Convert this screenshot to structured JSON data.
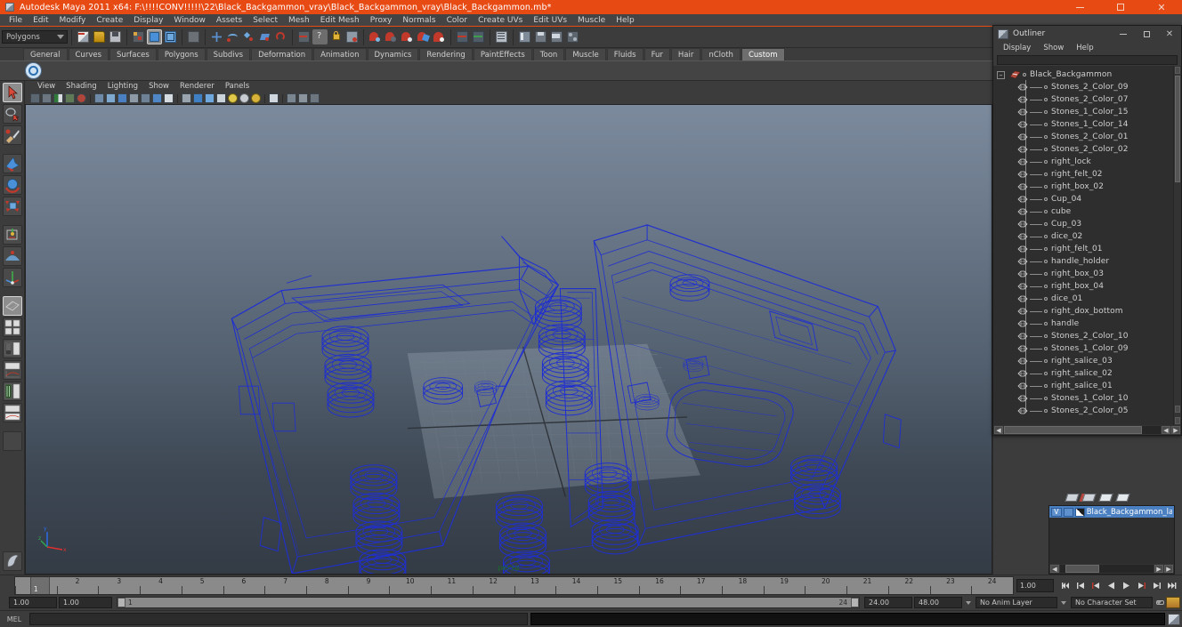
{
  "window": {
    "title": "Autodesk Maya 2011 x64: F:\\!!!!CONV!!!!!\\22\\Black_Backgammon_vray\\Black_Backgammon_vray\\Black_Backgammon.mb*",
    "app_icon": "maya-icon",
    "minimize": "minimize-icon",
    "maximize": "maximize-icon",
    "close": "close-icon",
    "titlebar_color": "#e84a14"
  },
  "menubar": {
    "items": [
      {
        "label": "File"
      },
      {
        "label": "Edit"
      },
      {
        "label": "Modify"
      },
      {
        "label": "Create"
      },
      {
        "label": "Display"
      },
      {
        "label": "Window"
      },
      {
        "label": "Assets"
      },
      {
        "label": "Select"
      },
      {
        "label": "Mesh"
      },
      {
        "label": "Edit Mesh"
      },
      {
        "label": "Proxy"
      },
      {
        "label": "Normals"
      },
      {
        "label": "Color"
      },
      {
        "label": "Create UVs"
      },
      {
        "label": "Edit UVs"
      },
      {
        "label": "Muscle"
      },
      {
        "label": "Help"
      }
    ]
  },
  "statusline": {
    "mode_selector": "Polygons",
    "icons": [
      "new-scene-icon",
      "open-scene-icon",
      "save-scene-icon",
      "select-by-hierarchy-icon",
      "select-by-object-icon",
      "select-by-component-icon",
      "select-mask-icon",
      "snap-to-grid-icon",
      "snap-to-curve-icon",
      "snap-to-point-icon",
      "snap-to-plane-icon",
      "snap-to-view-plane-icon",
      "snap-to-live-icon",
      "history-icon",
      "help-icon",
      "lock-icon",
      "render-current-frame-icon",
      "ipr-render-icon",
      "render-settings-icon",
      "hypershade-icon",
      "render-view-icon",
      "render-globals-icon",
      "show-hide-editor-icon",
      "open-editor-icon",
      "attribute-editor-icon",
      "channel-box-icon",
      "layer-editor-icon",
      "tool-settings-icon",
      "sidebar-toggle-icon"
    ]
  },
  "shelf": {
    "tabs": [
      {
        "label": "General",
        "active": false
      },
      {
        "label": "Curves",
        "active": false
      },
      {
        "label": "Surfaces",
        "active": false
      },
      {
        "label": "Polygons",
        "active": false
      },
      {
        "label": "Subdivs",
        "active": false
      },
      {
        "label": "Deformation",
        "active": false
      },
      {
        "label": "Animation",
        "active": false
      },
      {
        "label": "Dynamics",
        "active": false
      },
      {
        "label": "Rendering",
        "active": false
      },
      {
        "label": "PaintEffects",
        "active": false
      },
      {
        "label": "Toon",
        "active": false
      },
      {
        "label": "Muscle",
        "active": false
      },
      {
        "label": "Fluids",
        "active": false
      },
      {
        "label": "Fur",
        "active": false
      },
      {
        "label": "Hair",
        "active": false
      },
      {
        "label": "nCloth",
        "active": false
      },
      {
        "label": "Custom",
        "active": true
      }
    ],
    "buttons": [
      "vray-render-icon"
    ]
  },
  "toolbox": {
    "tools": [
      {
        "name": "select-tool",
        "selected": true
      },
      {
        "name": "lasso-select-tool",
        "selected": false
      },
      {
        "name": "paint-select-tool",
        "selected": false
      },
      {
        "name": "move-tool",
        "selected": false
      },
      {
        "name": "rotate-tool",
        "selected": false
      },
      {
        "name": "scale-tool",
        "selected": false
      },
      {
        "name": "universal-manipulator-tool",
        "selected": false
      },
      {
        "name": "soft-modification-tool",
        "selected": false
      },
      {
        "name": "last-tool-used",
        "selected": false
      }
    ],
    "layouts": [
      {
        "name": "single-perspective-layout",
        "selected": true
      },
      {
        "name": "four-view-layout",
        "selected": false
      },
      {
        "name": "outliner-persp-layout",
        "selected": false
      },
      {
        "name": "persp-graph-layout",
        "selected": false
      },
      {
        "name": "hypershade-persp-layout",
        "selected": false
      },
      {
        "name": "persp-graph-hypergraph-layout",
        "selected": false
      }
    ],
    "paint_icon": "paint-effects-icon"
  },
  "viewport": {
    "panel_menus": [
      {
        "label": "View"
      },
      {
        "label": "Shading"
      },
      {
        "label": "Lighting"
      },
      {
        "label": "Show"
      },
      {
        "label": "Renderer"
      },
      {
        "label": "Panels"
      }
    ],
    "panel_icons": [
      "select-camera-icon",
      "lock-camera-icon",
      "camera-attributes-icon",
      "bookmark-icon",
      "image-plane-icon",
      "two-d-pan-zoom-icon",
      "grid-toggle-icon",
      "film-gate-icon",
      "resolution-gate-icon",
      "field-chart-icon",
      "safe-action-icon",
      "safe-title-icon",
      "gate-mask-icon",
      "wireframe-icon",
      "smooth-shade-icon",
      "shaded-wireframe-icon",
      "hardware-texture-icon",
      "use-default-light-icon",
      "use-all-lights-icon",
      "shadows-icon",
      "xray-icon",
      "isolate-select-icon",
      "display-layers-icon",
      "paint-effects-globals-icon"
    ],
    "camera_label": "persp",
    "axis_labels": {
      "x": "x",
      "y": "y",
      "z": "z"
    },
    "wireframe_color": "#1f2fd0",
    "object": "Black_Backgammon board wireframe model"
  },
  "outliner": {
    "title": "Outliner",
    "icon": "outliner-window-icon",
    "minimize": "minimize-icon",
    "maximize": "maximize-icon",
    "close": "close-icon",
    "menus": [
      {
        "label": "Display"
      },
      {
        "label": "Show"
      },
      {
        "label": "Help"
      }
    ],
    "search_value": "",
    "search_placeholder": "",
    "root": {
      "label": "Black_Backgammon",
      "expanded": true
    },
    "items": [
      {
        "label": "Stones_2_Color_09"
      },
      {
        "label": "Stones_2_Color_07"
      },
      {
        "label": "Stones_1_Color_15"
      },
      {
        "label": "Stones_1_Color_14"
      },
      {
        "label": "Stones_2_Color_01"
      },
      {
        "label": "Stones_2_Color_02"
      },
      {
        "label": "right_lock"
      },
      {
        "label": "right_felt_02"
      },
      {
        "label": "right_box_02"
      },
      {
        "label": "Cup_04"
      },
      {
        "label": "cube"
      },
      {
        "label": "Cup_03"
      },
      {
        "label": "dice_02"
      },
      {
        "label": "right_felt_01"
      },
      {
        "label": "handle_holder"
      },
      {
        "label": "right_box_03"
      },
      {
        "label": "right_box_04"
      },
      {
        "label": "dice_01"
      },
      {
        "label": "right_dox_bottom"
      },
      {
        "label": "handle"
      },
      {
        "label": "Stones_2_Color_10"
      },
      {
        "label": "Stones_1_Color_09"
      },
      {
        "label": "right_salice_03"
      },
      {
        "label": "right_salice_02"
      },
      {
        "label": "right_salice_01"
      },
      {
        "label": "Stones_1_Color_10"
      },
      {
        "label": "Stones_2_Color_05"
      }
    ]
  },
  "layer_editor": {
    "toolbar_icons": [
      "new-layer-icon",
      "new-layer-from-selected-icon",
      "layer-up-icon",
      "layer-down-icon"
    ],
    "layers": [
      {
        "visibility": "V",
        "playback": "",
        "swatch": "layer-color-swatch",
        "name": "Black_Backgammon_layer",
        "selected": true
      }
    ]
  },
  "timeslider": {
    "start": 1,
    "end": 24,
    "current_frame": "1",
    "tick_labels": [
      "1",
      "2",
      "3",
      "4",
      "5",
      "6",
      "7",
      "8",
      "9",
      "10",
      "11",
      "12",
      "13",
      "14",
      "15",
      "16",
      "17",
      "18",
      "19",
      "20",
      "21",
      "22",
      "23",
      "24"
    ],
    "current_time_field": "1.00",
    "playback_buttons": [
      "go-to-start-icon",
      "step-back-key-icon",
      "step-back-frame-icon",
      "play-backwards-icon",
      "play-forwards-icon",
      "step-forward-frame-icon",
      "step-forward-key-icon",
      "go-to-end-icon"
    ]
  },
  "rangeslider": {
    "anim_start": "1.00",
    "range_start": "1.00",
    "range_start_label": "1",
    "range_end_label": "24",
    "range_end": "24.00",
    "anim_end": "48.00",
    "anim_layer": "No Anim Layer",
    "character_set": "No Character Set",
    "auto_key_icon": "auto-key-icon",
    "anim_prefs_icon": "animation-preferences-icon"
  },
  "commandline": {
    "language_label": "MEL",
    "input_value": "",
    "output_value": "",
    "help_icon": "script-editor-icon"
  }
}
